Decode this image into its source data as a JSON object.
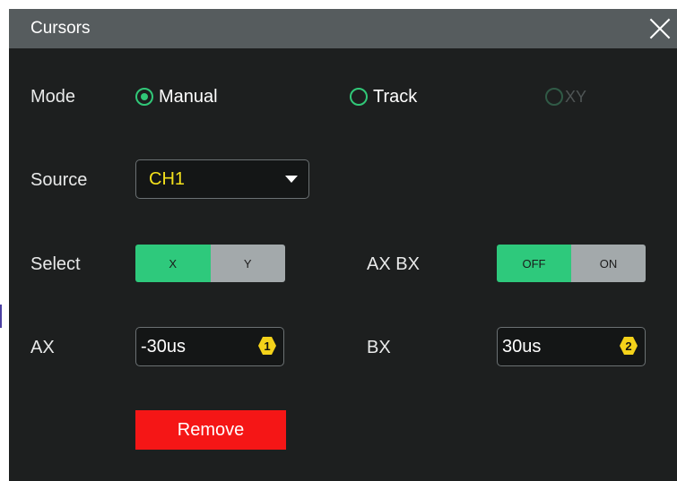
{
  "dialog": {
    "title": "Cursors"
  },
  "mode": {
    "label": "Mode",
    "options": [
      {
        "label": "Manual",
        "selected": true,
        "enabled": true
      },
      {
        "label": "Track",
        "selected": false,
        "enabled": true
      },
      {
        "label": "XY",
        "selected": false,
        "enabled": false
      }
    ]
  },
  "source": {
    "label": "Source",
    "value": "CH1"
  },
  "select": {
    "label": "Select",
    "options": [
      "X",
      "Y"
    ],
    "active": "X"
  },
  "axbx": {
    "label": "AX BX",
    "off_label": "OFF",
    "on_label": "ON",
    "active": "OFF"
  },
  "ax": {
    "label": "AX",
    "value": "-30us",
    "badge": "1"
  },
  "bx": {
    "label": "BX",
    "value": "30us",
    "badge": "2"
  },
  "remove_label": "Remove",
  "colors": {
    "accent": "#2ec97c",
    "danger": "#f51616",
    "channel": "#f4e11c",
    "badge": "#f4d21a"
  }
}
